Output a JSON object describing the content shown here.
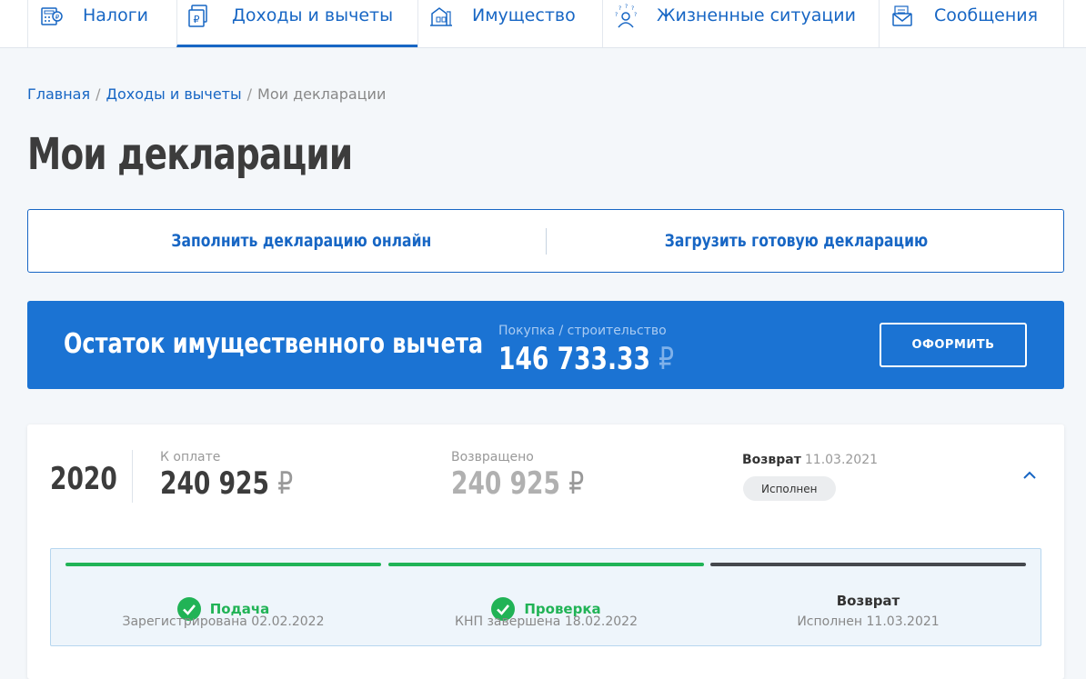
{
  "nav": {
    "tabs": [
      {
        "label": "Налоги",
        "icon": "calculator-icon"
      },
      {
        "label": "Доходы и вычеты",
        "icon": "ruble-document-icon"
      },
      {
        "label": "Имущество",
        "icon": "property-icon"
      },
      {
        "label": "Жизненные ситуации",
        "icon": "person-questions-icon"
      },
      {
        "label": "Сообщения",
        "icon": "envelope-icon"
      }
    ],
    "active_index": 1
  },
  "breadcrumb": {
    "home": "Главная",
    "section": "Доходы и вычеты",
    "current": "Мои декларации",
    "separator": "/"
  },
  "page": {
    "title": "Мои декларации"
  },
  "actions": {
    "fill_online": "Заполнить декларацию онлайн",
    "upload": "Загрузить готовую декларацию"
  },
  "banner": {
    "title": "Остаток имущественного вычета",
    "sub_label": "Покупка / строительство",
    "amount": "146 733.33",
    "currency": "₽",
    "button": "ОФОРМИТЬ"
  },
  "declaration": {
    "year": "2020",
    "to_pay_label": "К оплате",
    "to_pay": "240 925",
    "returned_label": "Возвращено",
    "returned": "240 925",
    "currency": "₽",
    "status_label": "Возврат",
    "status_date": "11.03.2021",
    "status_badge": "Исполнен",
    "steps": [
      {
        "title": "Подача",
        "sub": "Зарегистрирована 02.02.2022",
        "done": true
      },
      {
        "title": "Проверка",
        "sub": "КНП завершена 18.02.2022",
        "done": true
      },
      {
        "title": "Возврат",
        "sub": "Исполнен 11.03.2021",
        "done": false
      }
    ]
  },
  "colors": {
    "accent": "#1766c4",
    "banner": "#1b73d3",
    "success": "#21b356",
    "dark": "#3c3c3c"
  }
}
